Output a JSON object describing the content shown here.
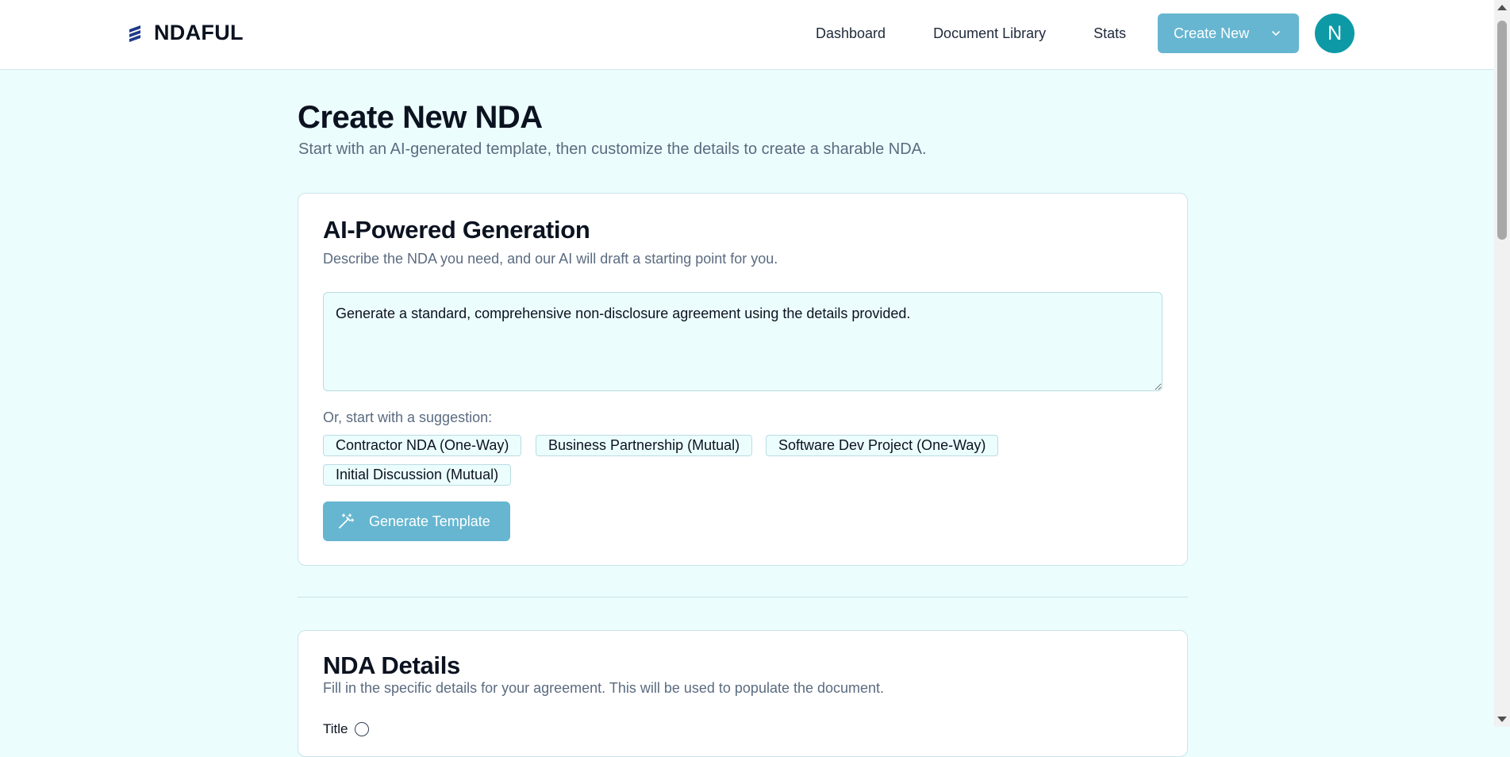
{
  "header": {
    "brand": "NDAFUL",
    "nav": [
      "Dashboard",
      "Document Library",
      "Stats"
    ],
    "create_button": "Create New",
    "avatar_initial": "N"
  },
  "page": {
    "title": "Create New NDA",
    "subtitle": "Start with an AI-generated template, then customize the details to create a sharable NDA."
  },
  "ai_card": {
    "title": "AI-Powered Generation",
    "description": "Describe the NDA you need, and our AI will draft a starting point for you.",
    "prompt_value": "Generate a standard, comprehensive non-disclosure agreement using the details provided.",
    "suggestion_label": "Or, start with a suggestion:",
    "suggestions": [
      "Contractor NDA (One-Way)",
      "Business Partnership (Mutual)",
      "Software Dev Project (One-Way)",
      "Initial Discussion (Mutual)"
    ],
    "generate_button": "Generate Template"
  },
  "details_card": {
    "title": "NDA Details",
    "description": "Fill in the specific details for your agreement. This will be used to populate the document.",
    "first_field_label": "Title"
  },
  "colors": {
    "page_background": "#ecfdfd",
    "primary_button": "#66b6d1",
    "avatar": "#0d9aa6",
    "card_border": "#c9e5ea"
  }
}
